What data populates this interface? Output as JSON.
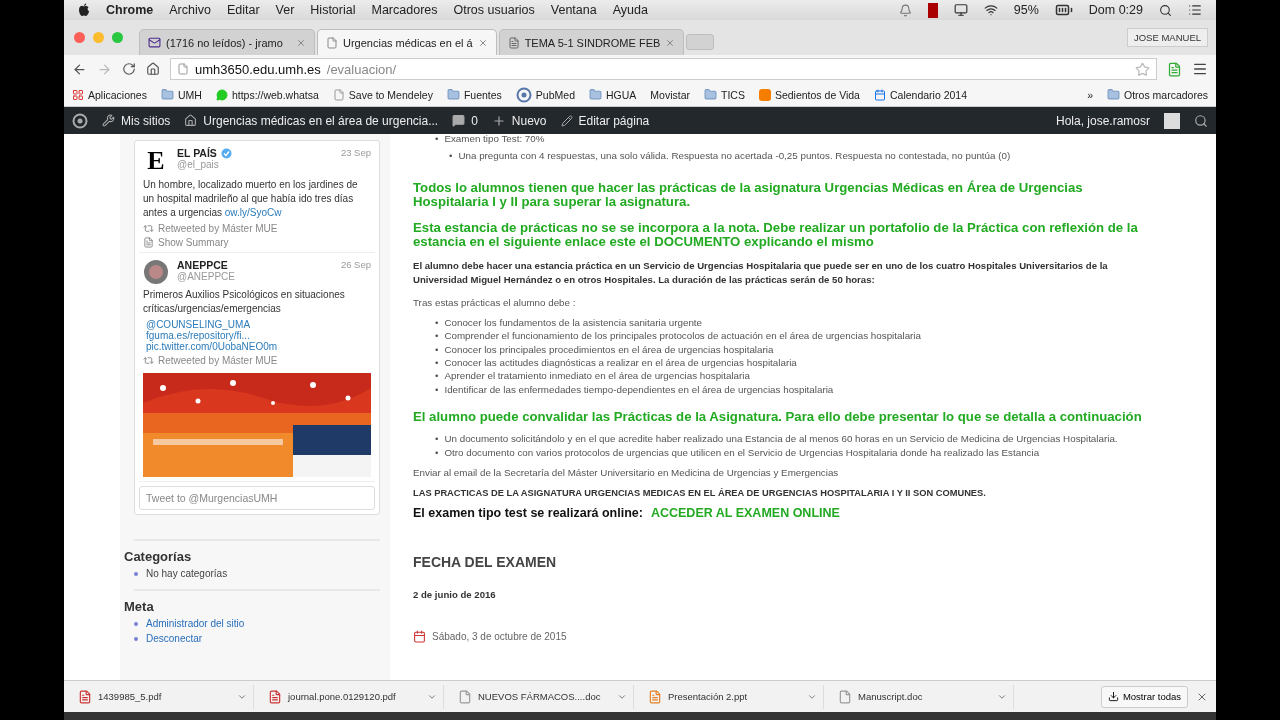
{
  "menubar": {
    "app": "Chrome",
    "menus": [
      "Archivo",
      "Editar",
      "Ver",
      "Historial",
      "Marcadores",
      "Otros usuarios",
      "Ventana",
      "Ayuda"
    ],
    "battery": "95%",
    "clock": "Dom 0:29"
  },
  "tabs": [
    {
      "title": "(1716 no leídos) - jramo",
      "kind": "mail",
      "selected": false
    },
    {
      "title": "Urgencias médicas en el á",
      "kind": "page",
      "selected": true
    },
    {
      "title": "TEMA 5-1 SINDROME FEB",
      "kind": "doc",
      "selected": false
    }
  ],
  "profile": "JOSE MANUEL",
  "address": {
    "host": "umh3650.edu.umh.es",
    "path": "/evaluacion/"
  },
  "bookmarks": [
    {
      "label": "Aplicaciones",
      "kind": "apps"
    },
    {
      "label": "UMH",
      "kind": "folder"
    },
    {
      "label": "https://web.whatsa",
      "kind": "chat"
    },
    {
      "label": "Save to Mendeley",
      "kind": "page"
    },
    {
      "label": "Fuentes",
      "kind": "folder"
    },
    {
      "label": "PubMed",
      "kind": "site"
    },
    {
      "label": "HGUA",
      "kind": "folder"
    },
    {
      "label": "Movistar",
      "kind": "none"
    },
    {
      "label": "TICS",
      "kind": "folder"
    },
    {
      "label": "Sedientos de Vida",
      "kind": "blog"
    },
    {
      "label": "Calendario 2014",
      "kind": "calendar"
    }
  ],
  "bookmarks_more": "»",
  "other_bookmarks": "Otros marcadores",
  "adminbar": {
    "items": [
      {
        "label": "Mis sitios",
        "kind": "sites"
      },
      {
        "label": "Urgencias médicas en el área de urgencia...",
        "kind": "home"
      },
      {
        "label": "0",
        "kind": "comments"
      },
      {
        "label": "Nuevo",
        "kind": "new"
      },
      {
        "label": "Editar página",
        "kind": "edit"
      }
    ],
    "greeting": "Hola, jose.ramosr"
  },
  "tweets": [
    {
      "name": "EL PAÍS",
      "verified": true,
      "handle": "@el_pais",
      "date": "23 Sep",
      "avatar": {
        "kind": "letter",
        "text": "E"
      },
      "text": "Un hombre, localizado muerto en los jardines de un hospital madrileño al que había ido tres días antes a urgencias",
      "links": [
        "ow.ly/SyoCw"
      ],
      "links_on_own_lines": false,
      "retweet": "Retweeted by Máster MUE",
      "summary": "Show Summary",
      "media": false
    },
    {
      "name": "ANEPPCE",
      "verified": false,
      "handle": "@ANEPPCE",
      "date": "26 Sep",
      "avatar": {
        "kind": "logo"
      },
      "text": "Primeros Auxilios Psicológicos en situaciones críticas/urgencias/emergencias",
      "links": [
        "@COUNSELING_UMA",
        "fguma.es/repository/fi...",
        "pic.twitter.com/0UobaNEO0m"
      ],
      "links_on_own_lines": true,
      "retweet": "Retweeted by Máster MUE",
      "media": true
    }
  ],
  "tweet_box": {
    "placeholder": "Tweet to @MurgenciasUMH"
  },
  "widgets": [
    {
      "title": "Categorías",
      "items": [
        {
          "label": "No hay categorías",
          "link": false
        }
      ]
    },
    {
      "title": "Meta",
      "items": [
        {
          "label": "Administrador del sitio",
          "link": true
        },
        {
          "label": "Desconectar",
          "link": true
        }
      ]
    }
  ],
  "content": [
    {
      "kind": "list",
      "bullet": "•",
      "items": [
        {
          "text": "Examen tipo Test: 70%",
          "children": [
            {
              "text": "Una pregunta con 4 respuestas, una solo válida. Respuesta no acertada -0,25 puntos. Respuesta no contestada, no puntúa (0)"
            }
          ]
        }
      ]
    },
    {
      "kind": "green",
      "text": "Todos lo alumnos tienen que hacer las prácticas de la asignatura Urgencias Médicas en Área de Urgencias Hospitalaria  I y II para superar la asignatura."
    },
    {
      "kind": "green",
      "text": "Esta estancia de prácticas no se se incorpora a la nota. Debe realizar un portafolio de la Práctica con reflexión de la estancia en el siguiente enlace este el DOCUMENTO explicando el mismo"
    },
    {
      "kind": "bold",
      "text": "El alumno debe hacer una estancia práctica en un Servicio de Urgencias Hospitalaria que puede ser en uno de los cuatro Hospitales Universitarios de la Universidad Miguel Hernández o en otros Hospitales.  La duración de las prácticas serán de 50 horas:"
    },
    {
      "kind": "plain",
      "text": "Tras estas prácticas el alumno debe :"
    },
    {
      "kind": "list",
      "bullet": "•",
      "items": [
        {
          "text": "Conocer los fundamentos de la asistencia sanitaria urgente"
        },
        {
          "text": "Comprender el funcionamiento de los principales protocolos de actuación en el área de urgencias hospitalaria"
        },
        {
          "text": "Conocer los principales procedimientos en el área de urgencias hospitalaria"
        },
        {
          "text": "Conocer las actitudes diagnósticas a realizar en el área de urgencias hospitalaria"
        },
        {
          "text": "Aprender  el tratamiento inmediato en el área de urgencias hospitalaria"
        },
        {
          "text": "Identificar  de las enfermedades tiempo-dependientes en el área de urgencias hospitalaria"
        }
      ]
    },
    {
      "kind": "green",
      "text": "El alumno puede convalidar las Prácticas de la Asignatura. Para ello debe presentar lo que se detalla a continuación"
    },
    {
      "kind": "list",
      "bullet": "•",
      "items": [
        {
          "text": "Un documento solicitándolo y en el que acredite haber realizado una Estancia de al menos 60 horas en un Servicio de Medicina de Urgencias Hospitalaria."
        },
        {
          "text": "Otro documento con varios protocolos de urgencias que utilicen en el Servicio de Urgencias Hospitalaria donde ha realizado las Estancia"
        }
      ]
    },
    {
      "kind": "plain",
      "text": "Enviar al email de la Secretaría del Máster Universitario en  Medicina de Urgencias y Emergencias"
    },
    {
      "kind": "caps",
      "text": "LAS PRACTICAS DE LA ASIGNATURA URGENCIAS MEDICAS EN EL ÁREA DE URGENCIAS HOSPITALARIA I Y II SON COMUNES."
    },
    {
      "kind": "lead-link",
      "text": "El examen tipo test se realizará online:",
      "link": "ACCEDER AL EXAMEN ONLINE"
    },
    {
      "kind": "heading",
      "text": "FECHA DEL EXAMEN"
    },
    {
      "kind": "bold",
      "text": "2 de junio de 2016"
    }
  ],
  "post_date": "Sábado, 3 de octubre de 2015",
  "downloads": [
    {
      "name": "1439985_5.pdf",
      "kind": "pdf"
    },
    {
      "name": "journal.pone.0129120.pdf",
      "kind": "pdf"
    },
    {
      "name": "NUEVOS FÁRMACOS....doc",
      "kind": "doc"
    },
    {
      "name": "Presentación 2.ppt",
      "kind": "ppt"
    },
    {
      "name": "Manuscript.doc",
      "kind": "doc"
    }
  ],
  "show_all": "Mostrar todas"
}
